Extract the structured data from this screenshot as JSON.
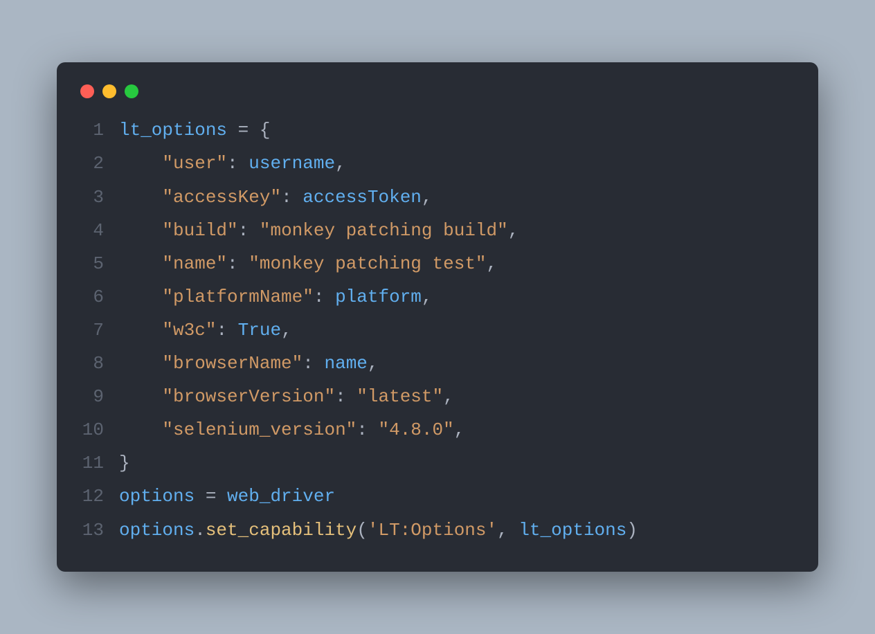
{
  "window": {
    "dots": {
      "red": "#ff5f56",
      "yellow": "#ffbd2e",
      "green": "#27c93f"
    }
  },
  "code": {
    "language": "python",
    "lines": [
      {
        "n": "1",
        "tokens": [
          {
            "t": "lt_options",
            "c": "ident"
          },
          {
            "t": " ",
            "c": "var"
          },
          {
            "t": "=",
            "c": "op"
          },
          {
            "t": " ",
            "c": "var"
          },
          {
            "t": "{",
            "c": "punct"
          }
        ]
      },
      {
        "n": "2",
        "tokens": [
          {
            "t": "    ",
            "c": "var"
          },
          {
            "t": "\"user\"",
            "c": "key"
          },
          {
            "t": ":",
            "c": "punct"
          },
          {
            "t": " ",
            "c": "var"
          },
          {
            "t": "username",
            "c": "ident"
          },
          {
            "t": ",",
            "c": "punct"
          }
        ]
      },
      {
        "n": "3",
        "tokens": [
          {
            "t": "    ",
            "c": "var"
          },
          {
            "t": "\"accessKey\"",
            "c": "key"
          },
          {
            "t": ":",
            "c": "punct"
          },
          {
            "t": " ",
            "c": "var"
          },
          {
            "t": "accessToken",
            "c": "ident"
          },
          {
            "t": ",",
            "c": "punct"
          }
        ]
      },
      {
        "n": "4",
        "tokens": [
          {
            "t": "    ",
            "c": "var"
          },
          {
            "t": "\"build\"",
            "c": "key"
          },
          {
            "t": ":",
            "c": "punct"
          },
          {
            "t": " ",
            "c": "var"
          },
          {
            "t": "\"monkey patching build\"",
            "c": "str"
          },
          {
            "t": ",",
            "c": "punct"
          }
        ]
      },
      {
        "n": "5",
        "tokens": [
          {
            "t": "    ",
            "c": "var"
          },
          {
            "t": "\"name\"",
            "c": "key"
          },
          {
            "t": ":",
            "c": "punct"
          },
          {
            "t": " ",
            "c": "var"
          },
          {
            "t": "\"monkey patching test\"",
            "c": "str"
          },
          {
            "t": ",",
            "c": "punct"
          }
        ]
      },
      {
        "n": "6",
        "tokens": [
          {
            "t": "    ",
            "c": "var"
          },
          {
            "t": "\"platformName\"",
            "c": "key"
          },
          {
            "t": ":",
            "c": "punct"
          },
          {
            "t": " ",
            "c": "var"
          },
          {
            "t": "platform",
            "c": "ident"
          },
          {
            "t": ",",
            "c": "punct"
          }
        ]
      },
      {
        "n": "7",
        "tokens": [
          {
            "t": "    ",
            "c": "var"
          },
          {
            "t": "\"w3c\"",
            "c": "key"
          },
          {
            "t": ":",
            "c": "punct"
          },
          {
            "t": " ",
            "c": "var"
          },
          {
            "t": "True",
            "c": "const"
          },
          {
            "t": ",",
            "c": "punct"
          }
        ]
      },
      {
        "n": "8",
        "tokens": [
          {
            "t": "    ",
            "c": "var"
          },
          {
            "t": "\"browserName\"",
            "c": "key"
          },
          {
            "t": ":",
            "c": "punct"
          },
          {
            "t": " ",
            "c": "var"
          },
          {
            "t": "name",
            "c": "ident"
          },
          {
            "t": ",",
            "c": "punct"
          }
        ]
      },
      {
        "n": "9",
        "tokens": [
          {
            "t": "    ",
            "c": "var"
          },
          {
            "t": "\"browserVersion\"",
            "c": "key"
          },
          {
            "t": ":",
            "c": "punct"
          },
          {
            "t": " ",
            "c": "var"
          },
          {
            "t": "\"latest\"",
            "c": "str"
          },
          {
            "t": ",",
            "c": "punct"
          }
        ]
      },
      {
        "n": "10",
        "tokens": [
          {
            "t": "    ",
            "c": "var"
          },
          {
            "t": "\"selenium_version\"",
            "c": "key"
          },
          {
            "t": ":",
            "c": "punct"
          },
          {
            "t": " ",
            "c": "var"
          },
          {
            "t": "\"4.8.0\"",
            "c": "str"
          },
          {
            "t": ",",
            "c": "punct"
          }
        ]
      },
      {
        "n": "11",
        "tokens": [
          {
            "t": "}",
            "c": "punct"
          }
        ]
      },
      {
        "n": "12",
        "tokens": [
          {
            "t": "options",
            "c": "ident"
          },
          {
            "t": " ",
            "c": "var"
          },
          {
            "t": "=",
            "c": "op"
          },
          {
            "t": " ",
            "c": "var"
          },
          {
            "t": "web_driver",
            "c": "ident"
          }
        ]
      },
      {
        "n": "13",
        "tokens": [
          {
            "t": "options",
            "c": "ident"
          },
          {
            "t": ".",
            "c": "punct"
          },
          {
            "t": "set_capability",
            "c": "func"
          },
          {
            "t": "(",
            "c": "punct"
          },
          {
            "t": "'LT:Options'",
            "c": "str"
          },
          {
            "t": ",",
            "c": "punct"
          },
          {
            "t": " ",
            "c": "var"
          },
          {
            "t": "lt_options",
            "c": "ident"
          },
          {
            "t": ")",
            "c": "punct"
          }
        ]
      }
    ]
  }
}
